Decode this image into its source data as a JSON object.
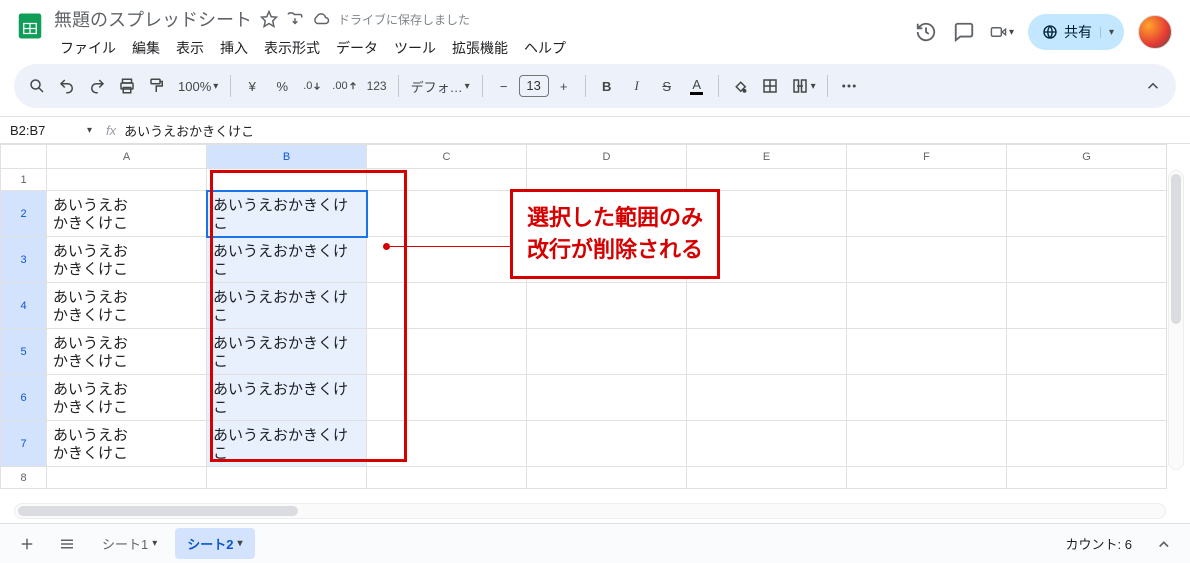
{
  "header": {
    "title": "無題のスプレッドシート",
    "saved_text": "ドライブに保存しました",
    "menus": [
      "ファイル",
      "編集",
      "表示",
      "挿入",
      "表示形式",
      "データ",
      "ツール",
      "拡張機能",
      "ヘルプ"
    ],
    "share_label": "共有"
  },
  "toolbar": {
    "zoom": "100%",
    "currency": "¥",
    "percent": "%",
    "dec_dec": ".0",
    "inc_dec": ".00",
    "number_fmt": "123",
    "font_name": "デフォ…",
    "font_size": "13"
  },
  "fx": {
    "namebox": "B2:B7",
    "formula": "あいうえおかきくけこ"
  },
  "columns": [
    "A",
    "B",
    "C",
    "D",
    "E",
    "F",
    "G"
  ],
  "rows": [
    {
      "n": "1",
      "a": "",
      "b": "",
      "tall": false
    },
    {
      "n": "2",
      "a": "あいうえお\nかきくけこ",
      "b": "あいうえおかきくけこ",
      "tall": true
    },
    {
      "n": "3",
      "a": "あいうえお\nかきくけこ",
      "b": "あいうえおかきくけこ",
      "tall": true
    },
    {
      "n": "4",
      "a": "あいうえお\nかきくけこ",
      "b": "あいうえおかきくけこ",
      "tall": true
    },
    {
      "n": "5",
      "a": "あいうえお\nかきくけこ",
      "b": "あいうえおかきくけこ",
      "tall": true
    },
    {
      "n": "6",
      "a": "あいうえお\nかきくけこ",
      "b": "あいうえおかきくけこ",
      "tall": true
    },
    {
      "n": "7",
      "a": "あいうえお\nかきくけこ",
      "b": "あいうえおかきくけこ",
      "tall": true
    },
    {
      "n": "8",
      "a": "",
      "b": "",
      "tall": false
    }
  ],
  "callout": {
    "line1": "選択した範囲のみ",
    "line2": "改行が削除される"
  },
  "sheets": {
    "tabs": [
      {
        "label": "シート1",
        "active": false
      },
      {
        "label": "シート2",
        "active": true
      }
    ],
    "count_label": "カウント: 6"
  }
}
